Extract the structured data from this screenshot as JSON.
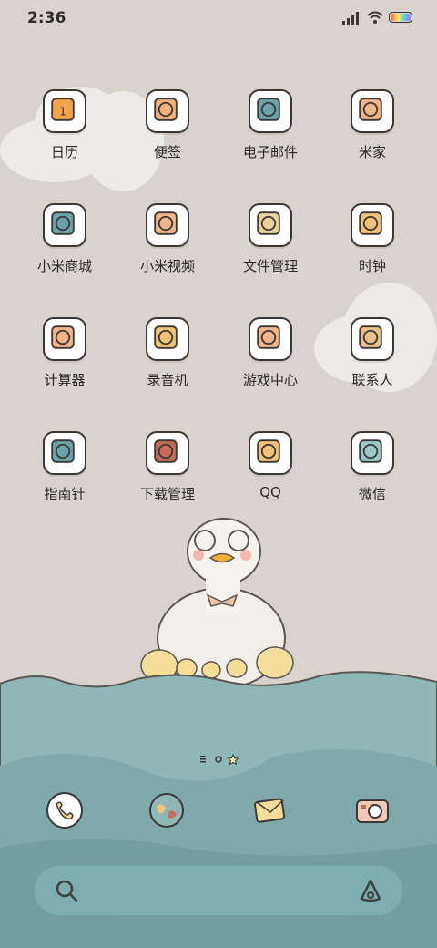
{
  "status": {
    "time": "2:36"
  },
  "apps": [
    {
      "label": "日历",
      "icon": "calendar-icon",
      "accent": "#f3a34c",
      "number": "1"
    },
    {
      "label": "便签",
      "icon": "notes-icon",
      "accent": "#f2b27a"
    },
    {
      "label": "电子邮件",
      "icon": "email-icon",
      "accent": "#6aa3a8"
    },
    {
      "label": "米家",
      "icon": "mijia-icon",
      "accent": "#f2b58a"
    },
    {
      "label": "小米商城",
      "icon": "store-icon",
      "accent": "#6aa3a8"
    },
    {
      "label": "小米视频",
      "icon": "video-icon",
      "accent": "#f2b58a"
    },
    {
      "label": "文件管理",
      "icon": "files-icon",
      "accent": "#e8d39a"
    },
    {
      "label": "时钟",
      "icon": "clock-bell-icon",
      "accent": "#f2c27a"
    },
    {
      "label": "计算器",
      "icon": "calculator-icon",
      "accent": "#f2b58a"
    },
    {
      "label": "录音机",
      "icon": "recorder-icon",
      "accent": "#f2c27a"
    },
    {
      "label": "游戏中心",
      "icon": "game-center-icon",
      "accent": "#f2b58a"
    },
    {
      "label": "联系人",
      "icon": "contacts-icon",
      "accent": "#e8c08a"
    },
    {
      "label": "指南针",
      "icon": "compass-icon",
      "accent": "#6aa3a8"
    },
    {
      "label": "下载管理",
      "icon": "download-icon",
      "accent": "#c66b5a"
    },
    {
      "label": "QQ",
      "icon": "qq-icon",
      "accent": "#f2c27a"
    },
    {
      "label": "微信",
      "icon": "wechat-icon",
      "accent": "#9bc7c9"
    }
  ],
  "dock": [
    {
      "icon": "phone-icon"
    },
    {
      "icon": "browser-icon"
    },
    {
      "icon": "messages-icon"
    },
    {
      "icon": "camera-icon"
    }
  ],
  "page_indicator": {
    "pages": 3,
    "current": 2
  },
  "search": {
    "left_icon": "search-icon",
    "right_icon": "assistant-icon"
  },
  "colors": {
    "background": "#d8d3cd",
    "sea": "#8fb7b8",
    "cloud": "#ecebe8"
  }
}
